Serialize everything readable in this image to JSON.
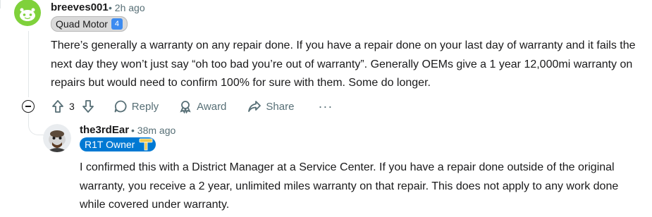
{
  "comment": {
    "username": "breeves001",
    "time": "• 2h ago",
    "flair": "Quad Motor",
    "flair_icon": "4-icon",
    "body": "There’s generally a warranty on any repair done. If you have a repair done on your last day of warranty and it fails the next day they won’t just say “oh too bad you’re out of warranty”. Generally OEMs give a 1 year 12,000mi warranty on repairs but would need to confirm 100% for sure with them. Some do longer.",
    "votes": "3"
  },
  "actions": {
    "reply": "Reply",
    "award": "Award",
    "share": "Share",
    "more": "···"
  },
  "reply": {
    "username": "the3rdEar",
    "time": "• 38m ago",
    "flair": "R1T Owner",
    "flair_icon": "hammer-icon",
    "body": "I confirmed this with a District Manager at a Service Center. If you have a repair done outside of the original warranty, you receive a 2 year, unlimited miles warranty on that repair. This does not apply to any work done while covered under warranty."
  },
  "colors": {
    "flair_blue": "#0079d3",
    "meta_gray": "#576f76",
    "avatar_green": "#7fd13b"
  }
}
